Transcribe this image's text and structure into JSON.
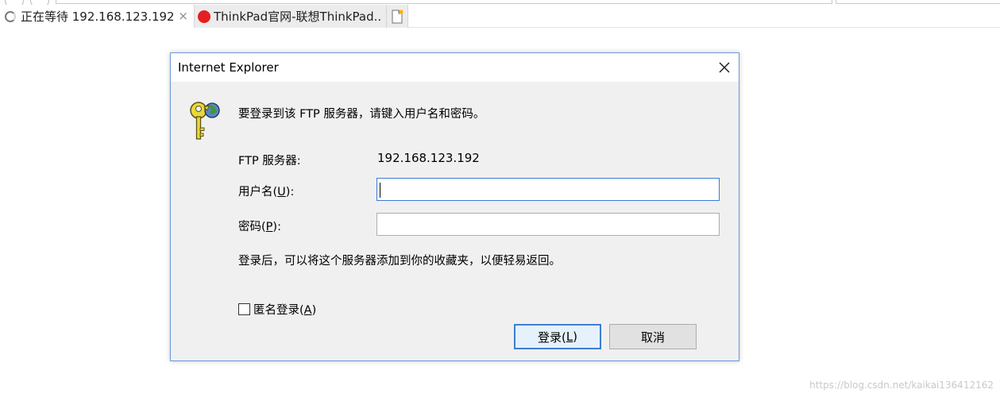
{
  "tabs": [
    {
      "title": "正在等待 192.168.123.192",
      "close": "×"
    },
    {
      "title": "ThinkPad官网-联想ThinkPad..."
    }
  ],
  "dialog": {
    "title": "Internet Explorer",
    "prompt": "要登录到该 FTP 服务器，请键入用户名和密码。",
    "server_label": "FTP 服务器:",
    "server_value": "192.168.123.192",
    "username_label": "用户名(",
    "username_key": "U",
    "username_value": "",
    "password_label": "密码(",
    "password_key": "P",
    "password_value": "",
    "label_suffix": "):",
    "note": "登录后，可以将这个服务器添加到你的收藏夹，以便轻易返回。",
    "anonymous_label": "匿名登录(",
    "anonymous_key": "A",
    "anonymous_checked": false,
    "paren_close": ")",
    "login_button": "登录(",
    "login_key": "L",
    "cancel_button": "取消"
  },
  "icons": {
    "spinner": "loading-spinner-icon",
    "favicon": "thinkpad-favicon-icon",
    "new_tab": "new-tab-icon",
    "close": "close-icon",
    "keys": "ftp-keys-icon"
  },
  "watermark": "https://blog.csdn.net/kaikai136412162",
  "colors": {
    "focus_border": "#3a7bd5",
    "dialog_bg": "#f0f0f0",
    "favicon_red": "#e51f1f"
  }
}
